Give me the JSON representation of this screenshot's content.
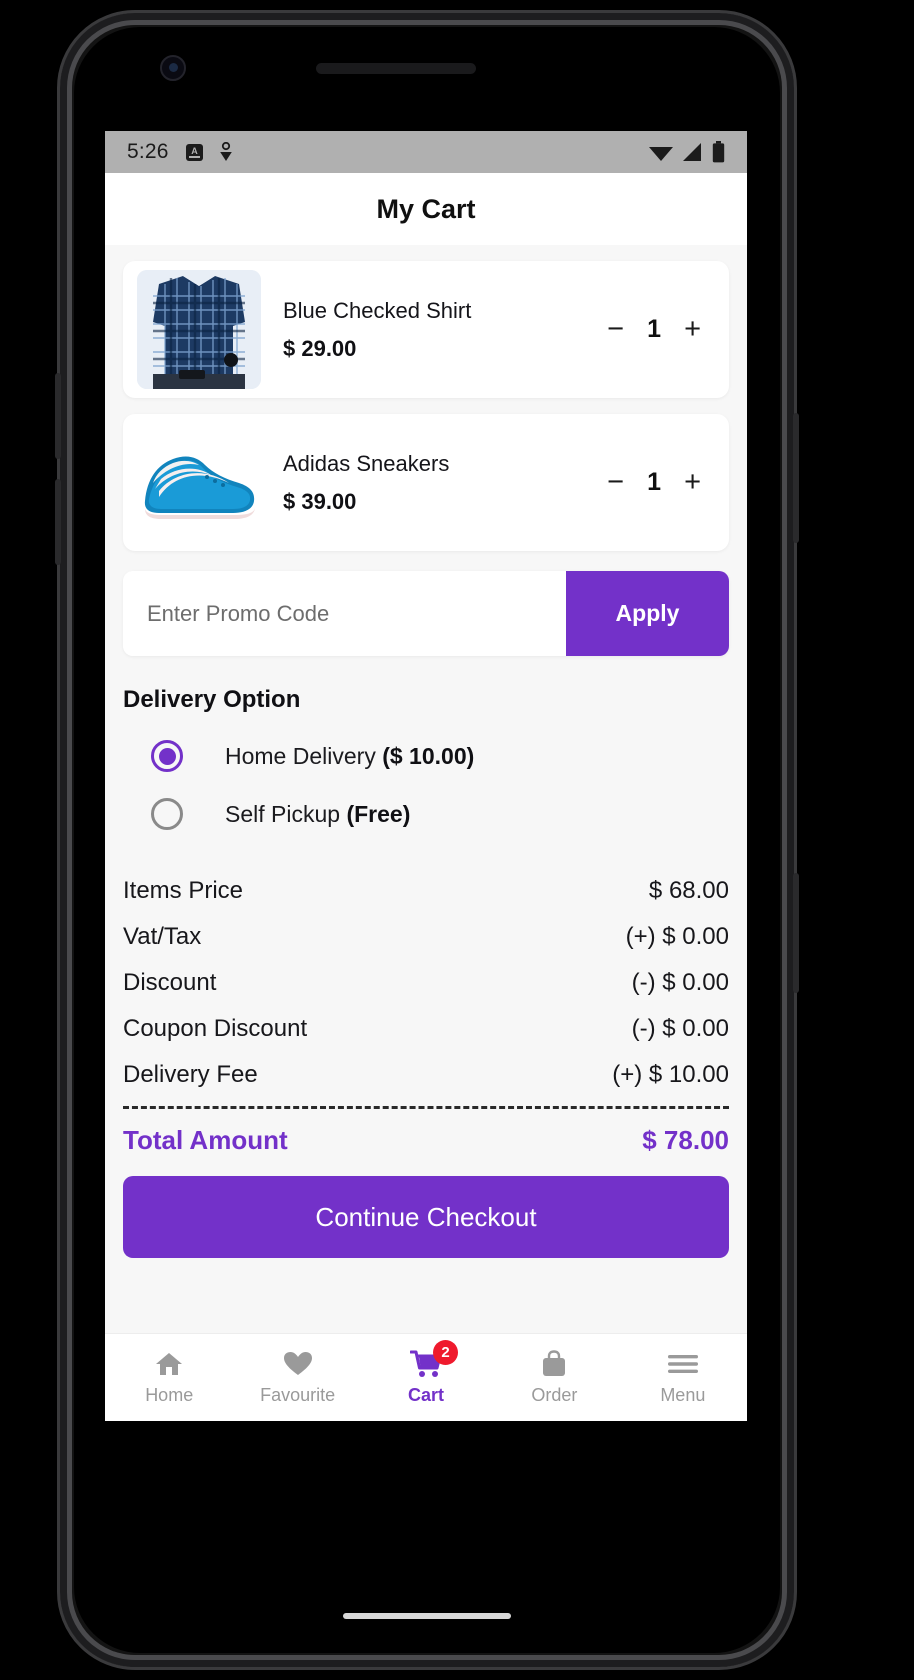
{
  "status_bar": {
    "time": "5:26",
    "left_icons": [
      "alarm-badge-icon",
      "person-pin-icon"
    ],
    "right_icons": [
      "wifi-icon",
      "signal-icon",
      "battery-icon"
    ]
  },
  "header": {
    "title": "My Cart"
  },
  "cart_items": [
    {
      "name": "Blue Checked Shirt",
      "price": "$ 29.00",
      "quantity": "1",
      "decrement_label": "−",
      "increment_label": "+",
      "image": "blue-checked-shirt-photo"
    },
    {
      "name": "Adidas Sneakers",
      "price": "$ 39.00",
      "quantity": "1",
      "decrement_label": "−",
      "increment_label": "+",
      "image": "blue-sneaker-photo"
    }
  ],
  "promo": {
    "placeholder": "Enter Promo Code",
    "value": "",
    "apply_label": "Apply"
  },
  "delivery": {
    "title": "Delivery Option",
    "options": [
      {
        "label": "Home Delivery",
        "price": "($ 10.00)",
        "selected": true
      },
      {
        "label": "Self Pickup",
        "price": "(Free)",
        "selected": false
      }
    ]
  },
  "summary": {
    "rows": [
      {
        "label": "Items Price",
        "value": "$ 68.00"
      },
      {
        "label": "Vat/Tax",
        "value": "(+) $ 0.00"
      },
      {
        "label": "Discount",
        "value": "(-) $ 0.00"
      },
      {
        "label": "Coupon Discount",
        "value": "(-) $ 0.00"
      },
      {
        "label": "Delivery Fee",
        "value": "(+) $ 10.00"
      }
    ],
    "total_label": "Total Amount",
    "total_value": "$ 78.00"
  },
  "checkout": {
    "label": "Continue Checkout"
  },
  "bottom_nav": {
    "items": [
      {
        "label": "Home",
        "icon": "home-icon",
        "active": false
      },
      {
        "label": "Favourite",
        "icon": "heart-icon",
        "active": false
      },
      {
        "label": "Cart",
        "icon": "cart-icon",
        "active": true,
        "badge": "2"
      },
      {
        "label": "Order",
        "icon": "bag-icon",
        "active": false
      },
      {
        "label": "Menu",
        "icon": "hamburger-icon",
        "active": false
      }
    ]
  },
  "colors": {
    "accent": "#7331c9",
    "badge": "#ef1a2d",
    "inactive": "#9a9a9a",
    "background": "#f7f7f7"
  }
}
